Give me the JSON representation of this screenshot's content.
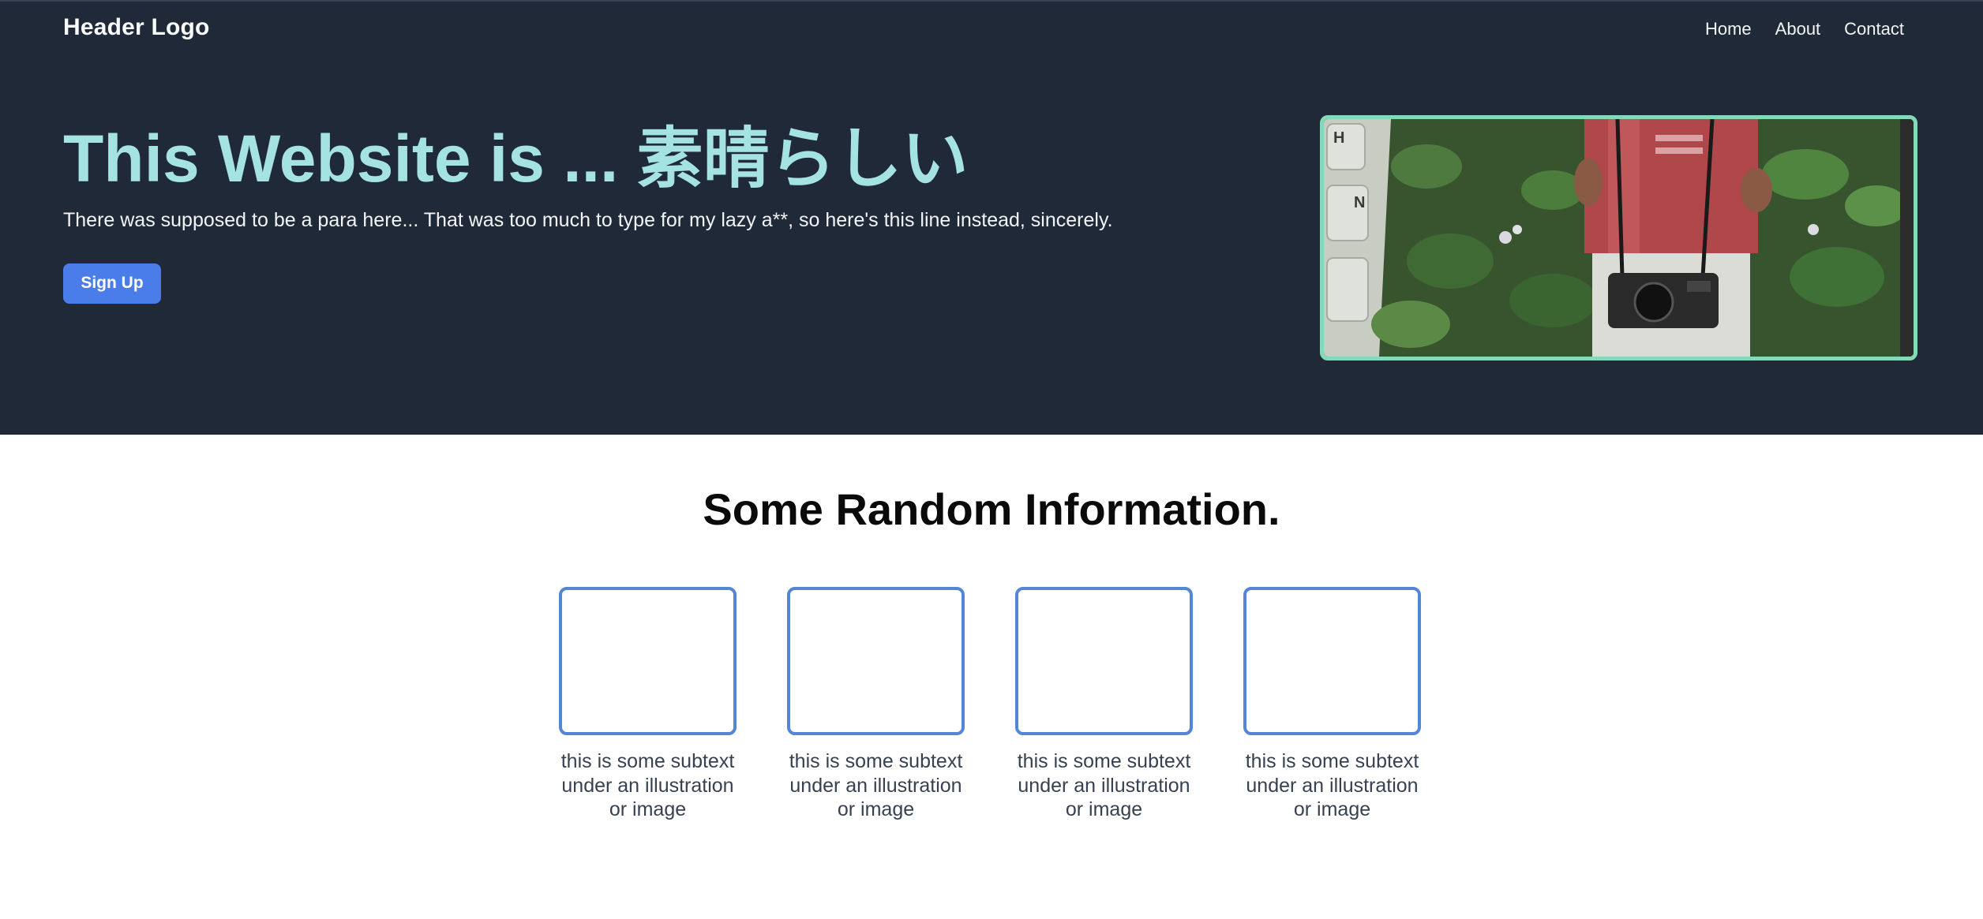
{
  "header": {
    "logo": "Header Logo",
    "nav": [
      "Home",
      "About",
      "Contact"
    ]
  },
  "hero": {
    "title": "This Website is ... 素晴らしい",
    "lead": "There was supposed to be a para here... That was too much to type for my lazy a**, so here's this line instead, sincerely.",
    "cta_label": "Sign Up",
    "image_subject": "person with camera among green leaves, keyboard edge",
    "colors": {
      "background": "#1f2937",
      "title": "#a5e3e3",
      "button": "#4a7dea",
      "image_border": "#86d9b8"
    }
  },
  "info": {
    "title": "Some Random Information.",
    "cards": [
      {
        "caption": "this is some subtext under an illustration or image"
      },
      {
        "caption": "this is some subtext under an illustration or image"
      },
      {
        "caption": "this is some subtext under an illustration or image"
      },
      {
        "caption": "this is some subtext under an illustration or image"
      }
    ],
    "card_border_color": "#5585d6"
  }
}
